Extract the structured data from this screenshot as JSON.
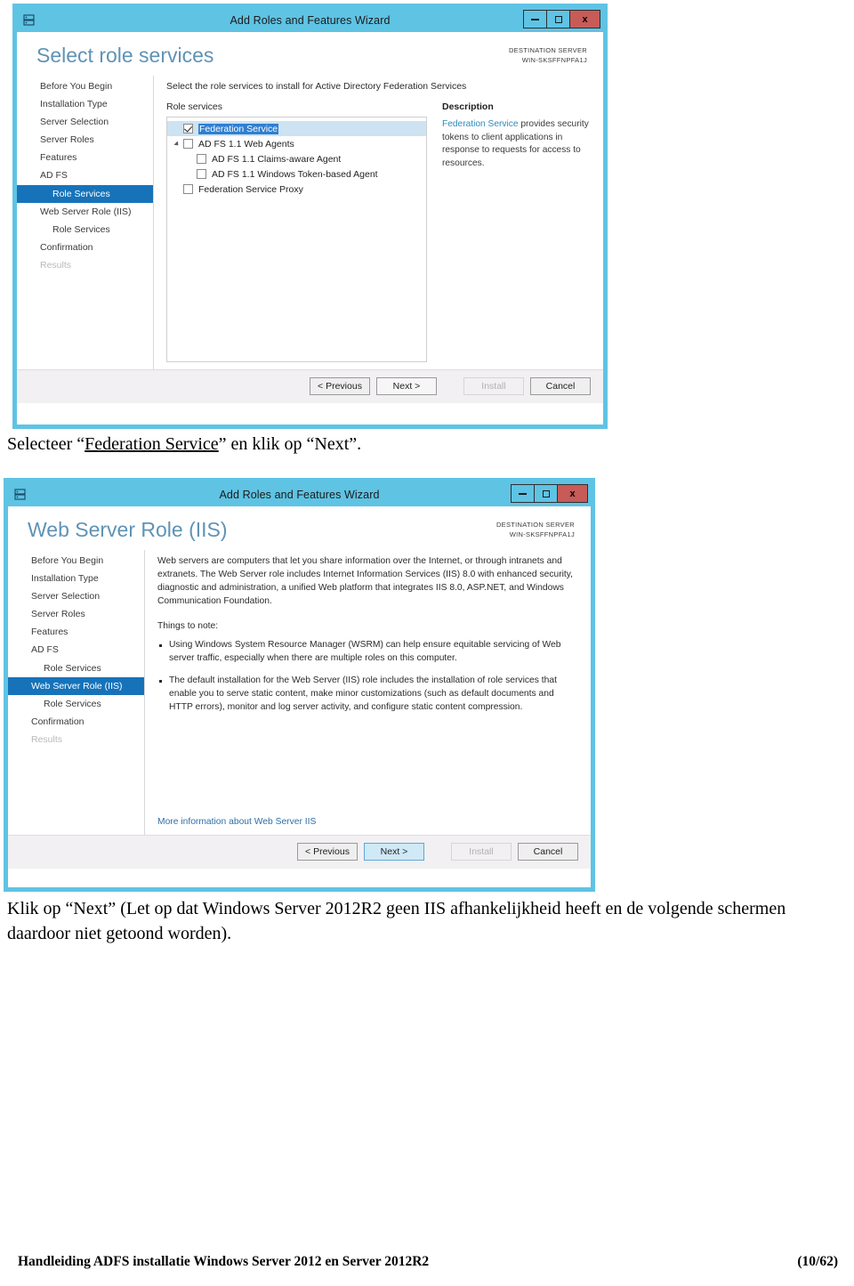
{
  "document": {
    "instruction_1": "Selecteer “Federation Service” en klik op “Next”.",
    "instruction_1_parts": {
      "before": "Selecteer “",
      "underlined": "Federation Service",
      "after": "” en klik op “Next”."
    },
    "instruction_2": "Klik op “Next”  (Let op dat Windows Server 2012R2 geen IIS afhankelijkheid heeft en de volgende schermen daardoor niet getoond worden).",
    "footer_left": "Handleiding ADFS installatie Windows Server 2012 en Server 2012R2",
    "footer_right": "(10/62)"
  },
  "colors": {
    "titlebar": "#5fc3e4",
    "close_button": "#c75b57",
    "nav_selected": "#1673ba",
    "heading": "#5f93b5",
    "accent_link": "#2e8bbd",
    "row_highlight": "#cde3f2",
    "text_selection": "#2f7fd1",
    "focused_button": "#cfe9f7"
  },
  "wizard1": {
    "titlebar": {
      "title": "Add Roles and Features Wizard",
      "icon": "server-roles-icon",
      "minimize_label": "–",
      "maximize_label": "□",
      "close_label": "x"
    },
    "heading": "Select role services",
    "destination_server": {
      "label": "DESTINATION SERVER",
      "name": "WIN-SKSFFNPFA1J"
    },
    "nav_items": [
      {
        "label": "Before You Begin",
        "state": "normal",
        "indent": 0
      },
      {
        "label": "Installation Type",
        "state": "normal",
        "indent": 0
      },
      {
        "label": "Server Selection",
        "state": "normal",
        "indent": 0
      },
      {
        "label": "Server Roles",
        "state": "normal",
        "indent": 0
      },
      {
        "label": "Features",
        "state": "normal",
        "indent": 0
      },
      {
        "label": "AD FS",
        "state": "normal",
        "indent": 0
      },
      {
        "label": "Role Services",
        "state": "selected",
        "indent": 1
      },
      {
        "label": "Web Server Role (IIS)",
        "state": "normal",
        "indent": 0
      },
      {
        "label": "Role Services",
        "state": "normal",
        "indent": 1
      },
      {
        "label": "Confirmation",
        "state": "normal",
        "indent": 0
      },
      {
        "label": "Results",
        "state": "disabled",
        "indent": 0
      }
    ],
    "lead_text": "Select the role services to install for Active Directory Federation Services",
    "services_label": "Role services",
    "services": [
      {
        "label": "Federation Service",
        "checked": true,
        "indent": 1,
        "expander": false,
        "selected": true,
        "highlight": true
      },
      {
        "label": "AD FS 1.1 Web Agents",
        "checked": false,
        "indent": 1,
        "expander": true,
        "selected": false,
        "highlight": false
      },
      {
        "label": "AD FS 1.1 Claims-aware Agent",
        "checked": false,
        "indent": 2,
        "expander": false,
        "selected": false,
        "highlight": false
      },
      {
        "label": "AD FS 1.1 Windows Token-based Agent",
        "checked": false,
        "indent": 2,
        "expander": false,
        "selected": false,
        "highlight": false
      },
      {
        "label": "Federation Service Proxy",
        "checked": false,
        "indent": 1,
        "expander": false,
        "selected": false,
        "highlight": false
      }
    ],
    "description": {
      "title": "Description",
      "accent_text": "Federation Service",
      "body_text": " provides security tokens to client applications in response to requests for access to resources."
    },
    "buttons": {
      "previous": "< Previous",
      "next": "Next >",
      "install": "Install",
      "cancel": "Cancel"
    }
  },
  "wizard2": {
    "titlebar": {
      "title": "Add Roles and Features Wizard",
      "icon": "server-roles-icon",
      "minimize_label": "–",
      "maximize_label": "□",
      "close_label": "x"
    },
    "heading": "Web Server Role (IIS)",
    "destination_server": {
      "label": "DESTINATION SERVER",
      "name": "WIN-SKSFFNPFA1J"
    },
    "nav_items": [
      {
        "label": "Before You Begin",
        "state": "normal",
        "indent": 0
      },
      {
        "label": "Installation Type",
        "state": "normal",
        "indent": 0
      },
      {
        "label": "Server Selection",
        "state": "normal",
        "indent": 0
      },
      {
        "label": "Server Roles",
        "state": "normal",
        "indent": 0
      },
      {
        "label": "Features",
        "state": "normal",
        "indent": 0
      },
      {
        "label": "AD FS",
        "state": "normal",
        "indent": 0
      },
      {
        "label": "Role Services",
        "state": "normal",
        "indent": 1
      },
      {
        "label": "Web Server Role (IIS)",
        "state": "selected",
        "indent": 0
      },
      {
        "label": "Role Services",
        "state": "normal",
        "indent": 1
      },
      {
        "label": "Confirmation",
        "state": "normal",
        "indent": 0
      },
      {
        "label": "Results",
        "state": "disabled",
        "indent": 0
      }
    ],
    "intro_paragraph": "Web servers are computers that let you share information over the Internet, or through intranets and extranets. The Web Server role includes Internet Information Services (IIS) 8.0 with enhanced security, diagnostic and administration, a unified Web platform that integrates IIS 8.0, ASP.NET, and Windows Communication Foundation.",
    "things_to_note_label": "Things to note:",
    "bullets": [
      "Using Windows System Resource Manager (WSRM) can help ensure equitable servicing of Web server traffic, especially when there are multiple roles on this computer.",
      "The default installation for the Web Server (IIS) role includes the installation of role services that enable you to serve static content, make minor customizations (such as default documents and HTTP errors), monitor and log server activity, and configure static content compression."
    ],
    "more_info_link": "More information about Web Server IIS",
    "buttons": {
      "previous": "< Previous",
      "next": "Next >",
      "install": "Install",
      "cancel": "Cancel"
    }
  }
}
